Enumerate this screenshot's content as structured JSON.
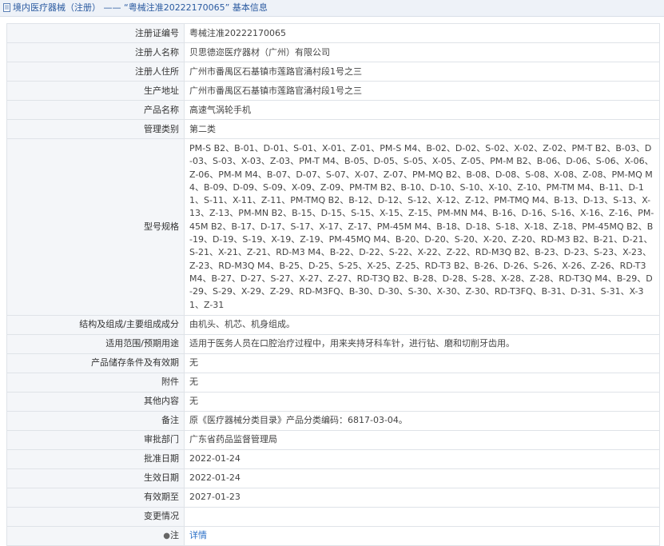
{
  "header": {
    "title": "境内医疗器械（注册） —— “粤械注准20222170065”  基本信息"
  },
  "rows": [
    {
      "label": "注册证编号",
      "value": "粤械注准20222170065"
    },
    {
      "label": "注册人名称",
      "value": "贝思德迩医疗器材（广州）有限公司"
    },
    {
      "label": "注册人住所",
      "value": "广州市番禺区石基镇市莲路官涌村段1号之三"
    },
    {
      "label": "生产地址",
      "value": "广州市番禺区石基镇市莲路官涌村段1号之三"
    },
    {
      "label": "产品名称",
      "value": "高速气涡轮手机"
    },
    {
      "label": "管理类别",
      "value": "第二类"
    },
    {
      "label": "型号规格",
      "value": "PM-S B2、B-01、D-01、S-01、X-01、Z-01、PM-S M4、B-02、D-02、S-02、X-02、Z-02、PM-T B2、B-03、D-03、S-03、X-03、Z-03、PM-T M4、B-05、D-05、S-05、X-05、Z-05、PM-M B2、B-06、D-06、S-06、X-06、Z-06、PM-M M4、B-07、D-07、S-07、X-07、Z-07、PM-MQ B2、B-08、D-08、S-08、X-08、Z-08、PM-MQ M4、B-09、D-09、S-09、X-09、Z-09、PM-TM B2、B-10、D-10、S-10、X-10、Z-10、PM-TM M4、B-11、D-11、S-11、X-11、Z-11、PM-TMQ B2、B-12、D-12、S-12、X-12、Z-12、PM-TMQ M4、B-13、D-13、S-13、X-13、Z-13、PM-MN B2、B-15、D-15、S-15、X-15、Z-15、PM-MN M4、B-16、D-16、S-16、X-16、Z-16、PM-45M B2、B-17、D-17、S-17、X-17、Z-17、PM-45M M4、B-18、D-18、S-18、X-18、Z-18、PM-45MQ B2、B-19、D-19、S-19、X-19、Z-19、PM-45MQ M4、B-20、D-20、S-20、X-20、Z-20、RD-M3 B2、B-21、D-21、S-21、X-21、Z-21、RD-M3 M4、B-22、D-22、S-22、X-22、Z-22、RD-M3Q B2、B-23、D-23、S-23、X-23、Z-23、RD-M3Q M4、B-25、D-25、S-25、X-25、Z-25、RD-T3 B2、B-26、D-26、S-26、X-26、Z-26、RD-T3 M4、B-27、D-27、S-27、X-27、Z-27、RD-T3Q B2、B-28、D-28、S-28、X-28、Z-28、RD-T3Q M4、B-29、D-29、S-29、X-29、Z-29、RD-M3FQ、B-30、D-30、S-30、X-30、Z-30、RD-T3FQ、B-31、D-31、S-31、X-31、Z-31",
      "tall": true
    },
    {
      "label": "结构及组成/主要组成成分",
      "value": "由机头、机芯、机身组成。"
    },
    {
      "label": "适用范围/预期用途",
      "value": "适用于医务人员在口腔治疗过程中，用来夹持牙科车针，进行钻、磨和切削牙齿用。"
    },
    {
      "label": "产品储存条件及有效期",
      "value": "无"
    },
    {
      "label": "附件",
      "value": "无"
    },
    {
      "label": "其他内容",
      "value": "无"
    },
    {
      "label": "备注",
      "value": "原《医疗器械分类目录》产品分类编码：6817-03-04。"
    },
    {
      "label": "审批部门",
      "value": "广东省药品监督管理局"
    },
    {
      "label": "批准日期",
      "value": "2022-01-24"
    },
    {
      "label": "生效日期",
      "value": "2022-01-24"
    },
    {
      "label": "有效期至",
      "value": "2027-01-23"
    },
    {
      "label": "变更情况",
      "value": ""
    }
  ],
  "note": {
    "label": "注",
    "link_text": "详情"
  }
}
